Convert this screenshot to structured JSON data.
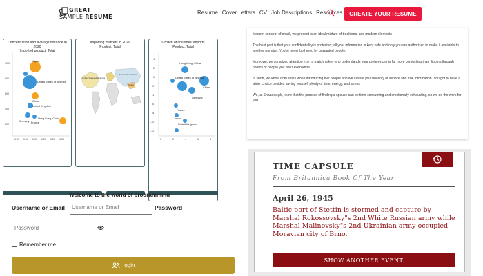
{
  "header": {
    "logo_line1": "GREAT",
    "logo_line2a": "SAMPLE",
    "logo_line2b": "RESUME",
    "nav": [
      "Resume",
      "Cover Letters",
      "CV",
      "Job Descriptions",
      "Resources"
    ],
    "cta_label": "CREATE YOUR RESUME",
    "accent_color": "#e8193c"
  },
  "panels": {
    "scatter": {
      "title_line1": "Concentration and average distance in 2020",
      "title_line2": "Imported product: Total",
      "y_ticks": [
        "1000",
        "800",
        "600",
        "400",
        "200"
      ],
      "x_ticks": [
        "0.05",
        "0.10",
        "0.15",
        "0.20",
        "0.25",
        "0.30"
      ],
      "labels": [
        "Japan",
        "United States of America",
        "China",
        "United Kingdom",
        "Germany",
        "Hong Kong, China",
        "France"
      ]
    },
    "map": {
      "title_line1": "Importing markets in 2020",
      "title_line2": "Product: Total",
      "labels": [
        "United States of America",
        "Russian Federation",
        "China"
      ]
    },
    "growth": {
      "title_line1": "Growth of countries' imports",
      "title_line2": "Product: Total",
      "y_ticks": [
        "4",
        "2",
        "0",
        "-2",
        "-4",
        "-6",
        "-8",
        "-10",
        "-12"
      ],
      "x_ticks": [
        "0",
        "2",
        "4",
        "6",
        "8"
      ],
      "labels": [
        "Hong Kong, China",
        "United States of America",
        "China",
        "Germany",
        "France",
        "Japan",
        "United Kingdom"
      ]
    }
  },
  "text_card": {
    "paragraphs": [
      "Modern concept of shadi, we present is an ideal mixture of traditional and modern elements",
      "The best part is that your confidentiality is protected; all your information is kept safe and only you are authorized to make it available to another member. You're never bothered by unwanted people.",
      "Moreover, personalized attention from a matchmaker who understands your preferences is far more comforting than flipping through photos of people you don't even know.",
      "In short, we know both sides when introducing two people and we assure you sincerity of service and true information. You got to have a wider choice besides saving yourself plenty of time, energy, and stress",
      "We, at Shaadee.pk, know that the process of finding a spouse can be time-consuming and emotionally exhausting, so we do the work for you."
    ]
  },
  "time_capsule": {
    "title": "TIME CAPSULE",
    "subtitle": "From Britannica Book Of The Year",
    "date": "April 26, 1945",
    "body": "Baltic port of Stettin is stormed and capture by Marshal Rokossovsky\"s 2nd White Russian army while Marshal Malinovsky\"s 2nd Ukrainian army occupied Moravian city of Brno.",
    "button_label": "SHOW ANOTHER EVENT",
    "brand_color": "#8b0f12"
  },
  "login": {
    "welcome": "Welcome to the world of programming",
    "username_label": "Username or Email",
    "username_placeholder": "Username or Email",
    "password_label": "Password",
    "password_placeholder": "Password",
    "remember_label": "Remember me",
    "login_label": "login",
    "button_color": "#b8962a"
  }
}
